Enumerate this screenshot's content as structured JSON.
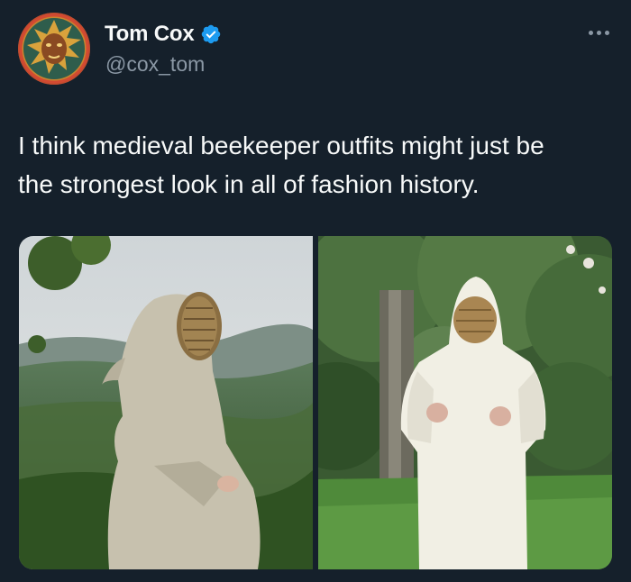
{
  "author": {
    "display_name": "Tom Cox",
    "handle": "@cox_tom",
    "verified_icon": "verified-badge-icon",
    "avatar_icon": "green-man-avatar"
  },
  "menu": {
    "icon": "more-options-icon"
  },
  "tweet": {
    "text_line1": "I think medieval beekeeper outfits might just be",
    "text_line2": "the strongest look in all of fashion history."
  },
  "media": {
    "photos": [
      {
        "subject": "beekeeper-in-hood-landscape"
      },
      {
        "subject": "beekeeper-in-robe-garden"
      }
    ]
  },
  "colors": {
    "background": "#15202b",
    "text_primary": "#f7f9f9",
    "text_secondary": "#8b98a5",
    "verified": "#1d9bf0"
  }
}
